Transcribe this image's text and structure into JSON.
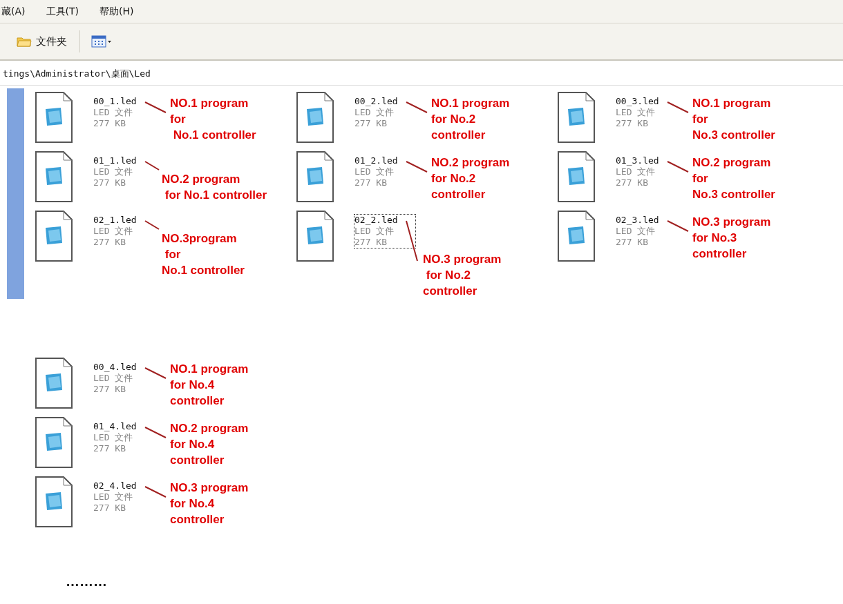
{
  "menu": [
    {
      "label": "藏(A)"
    },
    {
      "label": "工具(T)"
    },
    {
      "label": "帮助(H)"
    }
  ],
  "toolbar": {
    "folders_button": "文件夹"
  },
  "address": "tings\\Administrator\\桌面\\Led",
  "groups": [
    {
      "sidebar": true,
      "columns": [
        {
          "files": [
            {
              "name": "00_1.led",
              "type": "LED 文件",
              "size": "277 KB",
              "selected": false,
              "kind": "side",
              "note": "NO.1 program\nfor\n No.1 controller"
            },
            {
              "name": "01_1.led",
              "type": "LED 文件",
              "size": "277 KB",
              "selected": false,
              "kind": "low",
              "note": "NO.2 program\n for No.1 controller"
            },
            {
              "name": "02_1.led",
              "type": "LED 文件",
              "size": "277 KB",
              "selected": false,
              "kind": "low",
              "note": "NO.3program\n for\nNo.1 controller"
            }
          ]
        },
        {
          "files": [
            {
              "name": "00_2.led",
              "type": "LED 文件",
              "size": "277 KB",
              "selected": false,
              "kind": "side",
              "note": "NO.1 program\nfor No.2\ncontroller"
            },
            {
              "name": "01_2.led",
              "type": "LED 文件",
              "size": "277 KB",
              "selected": false,
              "kind": "side",
              "note": "NO.2 program\nfor No.2\ncontroller"
            },
            {
              "name": "02_2.led",
              "type": "LED 文件",
              "size": "277 KB",
              "selected": true,
              "kind": "below",
              "note": "NO.3 program\n for No.2\ncontroller"
            }
          ]
        },
        {
          "files": [
            {
              "name": "00_3.led",
              "type": "LED 文件",
              "size": "277 KB",
              "selected": false,
              "kind": "side",
              "note": "NO.1 program\nfor\nNo.3 controller"
            },
            {
              "name": "01_3.led",
              "type": "LED 文件",
              "size": "277 KB",
              "selected": false,
              "kind": "side",
              "note": "NO.2 program\nfor\nNo.3 controller"
            },
            {
              "name": "02_3.led",
              "type": "LED 文件",
              "size": "277 KB",
              "selected": false,
              "kind": "side",
              "note": "NO.3 program\nfor No.3\ncontroller"
            }
          ]
        }
      ]
    },
    {
      "sidebar": false,
      "columns": [
        {
          "files": [
            {
              "name": "00_4.led",
              "type": "LED 文件",
              "size": "277 KB",
              "selected": false,
              "kind": "side",
              "note": "NO.1 program\nfor No.4\ncontroller"
            },
            {
              "name": "01_4.led",
              "type": "LED 文件",
              "size": "277 KB",
              "selected": false,
              "kind": "side",
              "note": "NO.2 program\nfor No.4\ncontroller"
            },
            {
              "name": "02_4.led",
              "type": "LED 文件",
              "size": "277 KB",
              "selected": false,
              "kind": "side",
              "note": "NO.3 program\nfor No.4\ncontroller"
            }
          ]
        }
      ]
    }
  ],
  "ellipsis": "………"
}
